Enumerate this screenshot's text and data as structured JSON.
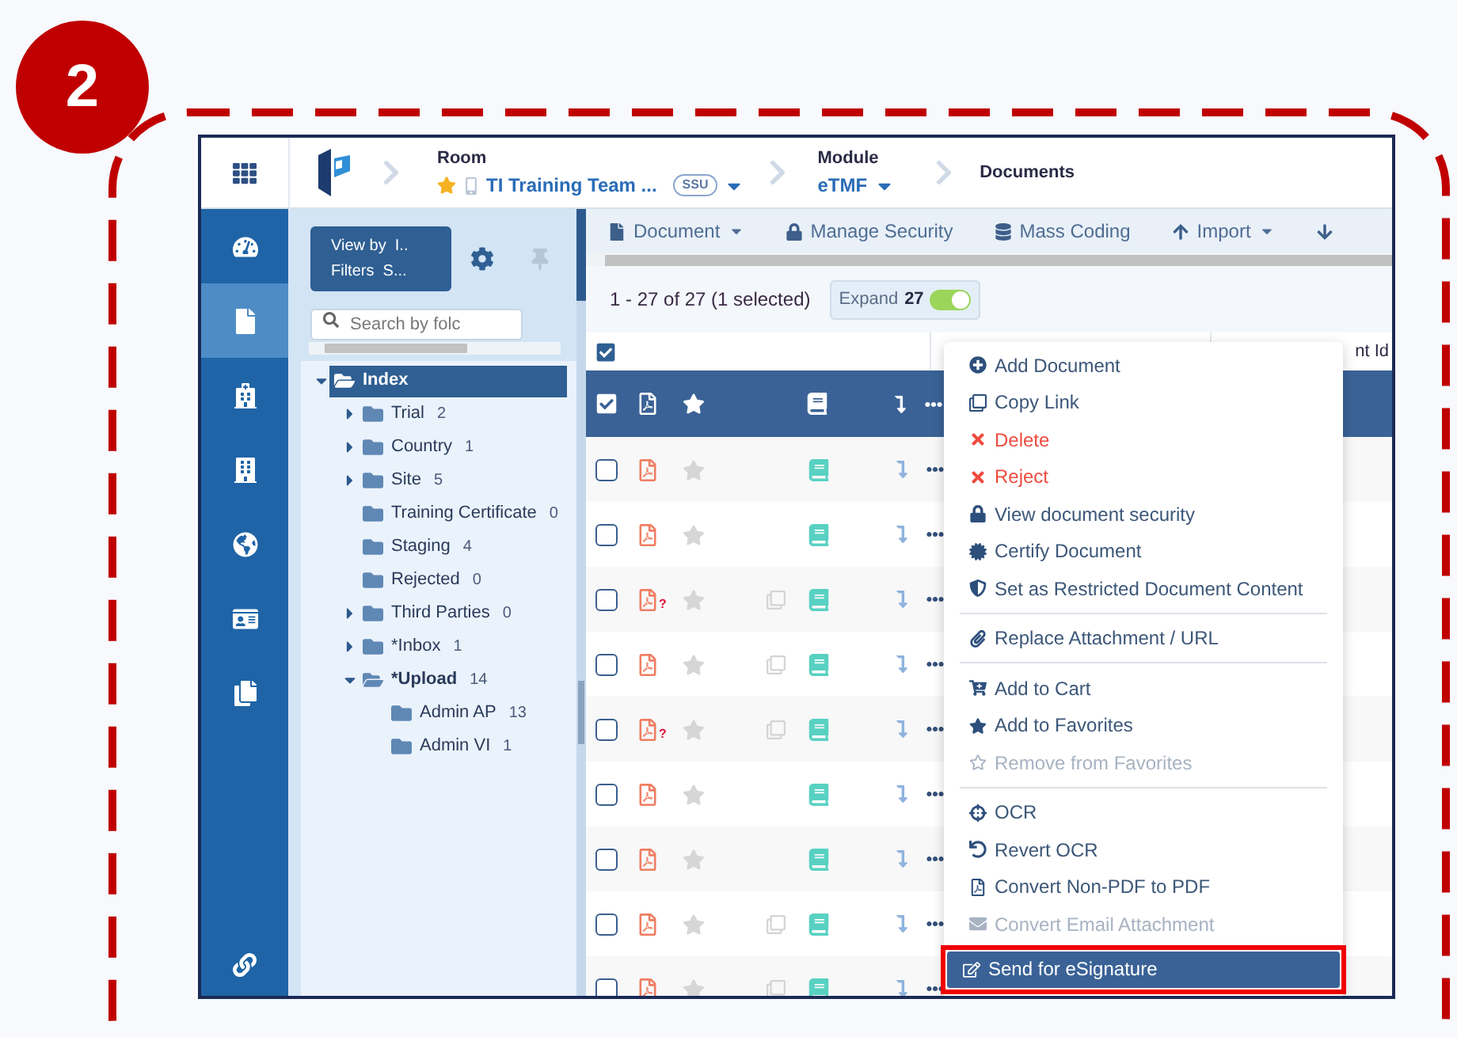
{
  "step_badge": "2",
  "topbar": {
    "crumbs": [
      {
        "kind": "room",
        "label": "Room",
        "value": "TI Training Team ...",
        "tag": "SSU",
        "favorite": true
      },
      {
        "kind": "module",
        "label": "Module",
        "value": "eTMF"
      },
      {
        "kind": "page",
        "label": "Documents"
      }
    ]
  },
  "rail": [
    {
      "selected": false
    },
    {
      "selected": true
    },
    {
      "selected": false
    },
    {
      "selected": false
    },
    {
      "selected": false
    },
    {
      "selected": false
    },
    {
      "selected": false
    }
  ],
  "tree_panel": {
    "view_by": "View by  I..",
    "filters": "Filters  S...",
    "search": {
      "placeholder": "Search by folc"
    },
    "tree": [
      {
        "label": "Index",
        "selected": true,
        "expanded": true,
        "children": [
          {
            "label": "Trial",
            "count": "2",
            "expandable": true,
            "expanded": false,
            "selected": false
          },
          {
            "label": "Country",
            "count": "1",
            "expandable": true,
            "expanded": false,
            "selected": false
          },
          {
            "label": "Site",
            "count": "5",
            "expandable": true,
            "expanded": false,
            "selected": false
          },
          {
            "label": "Training Certificate",
            "count": "0",
            "expandable": false,
            "expanded": false,
            "selected": false
          },
          {
            "label": "Staging",
            "count": "4",
            "expandable": false,
            "expanded": false,
            "selected": false
          },
          {
            "label": "Rejected",
            "count": "0",
            "expandable": false,
            "expanded": false,
            "selected": false
          },
          {
            "label": "Third Parties",
            "count": "0",
            "expandable": true,
            "expanded": false,
            "selected": false
          },
          {
            "label": "*Inbox",
            "count": "1",
            "expandable": true,
            "expanded": false,
            "selected": false
          },
          {
            "label": "*Upload",
            "count": "14",
            "expandable": true,
            "expanded": true,
            "selected": false,
            "children": [
              {
                "label": "Admin AP",
                "count": "13",
                "expandable": false,
                "expanded": false,
                "selected": false
              },
              {
                "label": "Admin VI",
                "count": "1",
                "expandable": false,
                "expanded": false,
                "selected": false
              }
            ]
          }
        ]
      }
    ]
  },
  "toolbar": [
    {
      "label": "Document",
      "dropdown": true
    },
    {
      "label": "Manage Security",
      "dropdown": false
    },
    {
      "label": "Mass Coding",
      "dropdown": false
    },
    {
      "label": "Import",
      "dropdown": true
    }
  ],
  "summary": "1 - 27 of 27 (1 selected)",
  "expand": {
    "label": "Expand",
    "count": "27",
    "on": true
  },
  "table": {
    "column_3": "nt Id",
    "rows": [
      {
        "checked": false,
        "note": null,
        "copy": false
      },
      {
        "checked": false,
        "note": null,
        "copy": false
      },
      {
        "checked": false,
        "note": "?",
        "copy": true
      },
      {
        "checked": false,
        "note": null,
        "copy": true
      },
      {
        "checked": false,
        "note": "?",
        "copy": true
      },
      {
        "checked": false,
        "note": null,
        "copy": false
      },
      {
        "checked": false,
        "note": null,
        "copy": false
      },
      {
        "checked": false,
        "note": null,
        "copy": true
      },
      {
        "checked": false,
        "note": null,
        "copy": true
      }
    ]
  },
  "context_menu": {
    "groups": [
      [
        {
          "label": "Add Document",
          "kind": "normal",
          "disabled": false,
          "selected": false
        },
        {
          "label": "Copy Link",
          "kind": "normal",
          "disabled": false,
          "selected": false
        },
        {
          "label": "Delete",
          "kind": "danger",
          "disabled": false,
          "selected": false
        },
        {
          "label": "Reject",
          "kind": "danger",
          "disabled": false,
          "selected": false
        },
        {
          "label": "View document security",
          "kind": "normal",
          "disabled": false,
          "selected": false
        },
        {
          "label": "Certify Document",
          "kind": "normal",
          "disabled": false,
          "selected": false
        },
        {
          "label": "Set as Restricted Document Content",
          "kind": "normal",
          "disabled": false,
          "selected": false
        }
      ],
      [
        {
          "label": "Replace Attachment / URL",
          "kind": "normal",
          "disabled": false,
          "selected": false
        }
      ],
      [
        {
          "label": "Add to Cart",
          "kind": "normal",
          "disabled": false,
          "selected": false
        },
        {
          "label": "Add to Favorites",
          "kind": "normal",
          "disabled": false,
          "selected": false
        },
        {
          "label": "Remove from Favorites",
          "kind": "normal",
          "disabled": true,
          "selected": false
        }
      ],
      [
        {
          "label": "OCR",
          "kind": "normal",
          "disabled": false,
          "selected": false
        },
        {
          "label": "Revert OCR",
          "kind": "normal",
          "disabled": false,
          "selected": false
        },
        {
          "label": "Convert Non-PDF to PDF",
          "kind": "normal",
          "disabled": false,
          "selected": false
        },
        {
          "label": "Convert Email Attachment",
          "kind": "normal",
          "disabled": true,
          "selected": false
        },
        {
          "label": "Send for eSignature",
          "kind": "normal",
          "disabled": false,
          "selected": true
        }
      ]
    ]
  }
}
